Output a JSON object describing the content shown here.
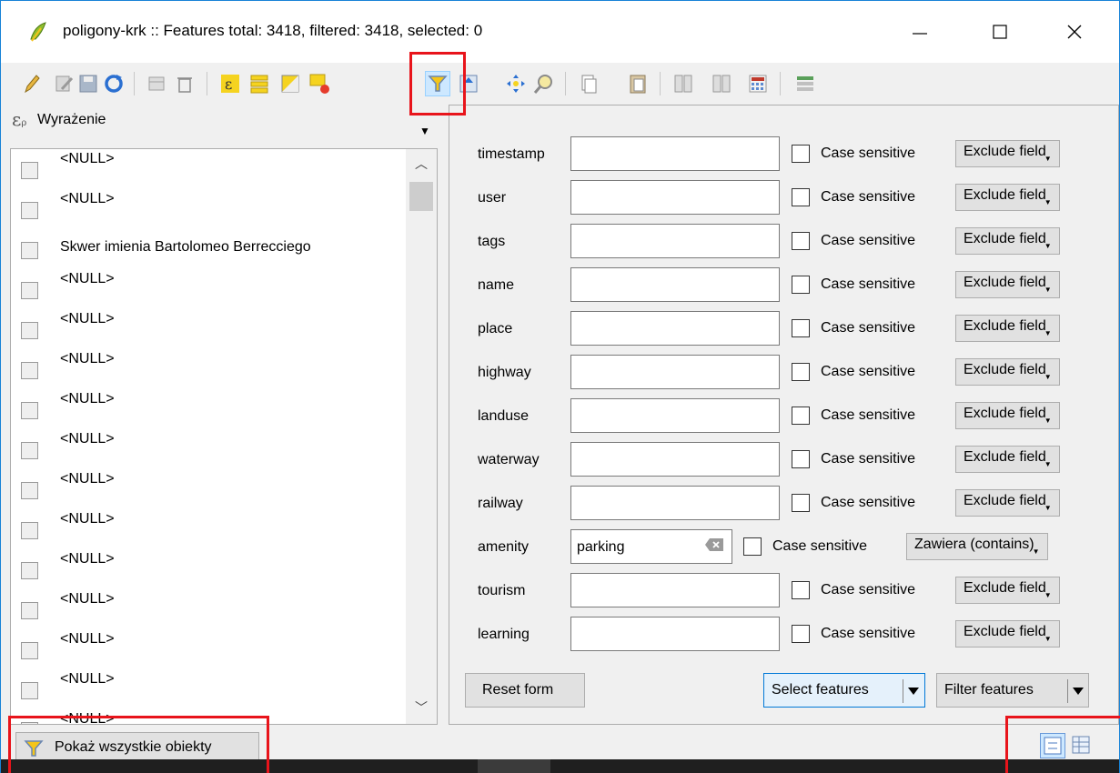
{
  "window": {
    "title": "poligony-krk :: Features total: 3418, filtered: 3418, selected: 0",
    "min_glyph": "—",
    "max_glyph": "☐",
    "close_glyph": "✕"
  },
  "toolbar": {
    "buttons": [
      "toggle-editing-icon",
      "multi-edit-icon",
      "save-edits-icon",
      "reload-icon",
      "add-feature-icon",
      "delete-feature-icon",
      "select-by-expression-icon",
      "select-all-icon",
      "invert-selection-icon",
      "deselect-all-icon",
      "filter-select-by-form-icon",
      "move-selection-to-top-icon",
      "pan-to-selected-icon",
      "zoom-to-selected-icon",
      "copy-features-icon",
      "paste-features-icon",
      "new-field-icon",
      "delete-field-icon",
      "field-calculator-icon",
      "conditional-formatting-icon"
    ],
    "active": "filter-select-by-form-icon"
  },
  "left_panel": {
    "expression_label": "Wyrażenie",
    "items": [
      "<NULL>",
      "<NULL>",
      "Skwer imienia Bartolomeo Berrecciego",
      "<NULL>",
      "<NULL>",
      "<NULL>",
      "<NULL>",
      "<NULL>",
      "<NULL>",
      "<NULL>",
      "<NULL>",
      "<NULL>",
      "<NULL>",
      "<NULL>",
      "<NULL>"
    ],
    "show_all_label": "Pokaż wszystkie obiekty"
  },
  "form": {
    "case_label": "Case sensitive",
    "fields": [
      {
        "name": "timestamp",
        "value": "",
        "mode": "Exclude field"
      },
      {
        "name": "user",
        "value": "",
        "mode": "Exclude field"
      },
      {
        "name": "tags",
        "value": "",
        "mode": "Exclude field"
      },
      {
        "name": "name",
        "value": "",
        "mode": "Exclude field"
      },
      {
        "name": "place",
        "value": "",
        "mode": "Exclude field"
      },
      {
        "name": "highway",
        "value": "",
        "mode": "Exclude field"
      },
      {
        "name": "landuse",
        "value": "",
        "mode": "Exclude field"
      },
      {
        "name": "waterway",
        "value": "",
        "mode": "Exclude field"
      },
      {
        "name": "railway",
        "value": "",
        "mode": "Exclude field"
      },
      {
        "name": "amenity",
        "value": "parking",
        "mode": "Zawiera (contains)"
      },
      {
        "name": "tourism",
        "value": "",
        "mode": "Exclude field"
      },
      {
        "name": "learning",
        "value": "",
        "mode": "Exclude field"
      }
    ],
    "reset_label": "Reset form",
    "select_label": "Select features",
    "filter_label": "Filter features"
  },
  "colors": {
    "highlight_box": "#e8141b",
    "window_border": "#1883d7",
    "active_tool_bg": "#cde8ff"
  }
}
